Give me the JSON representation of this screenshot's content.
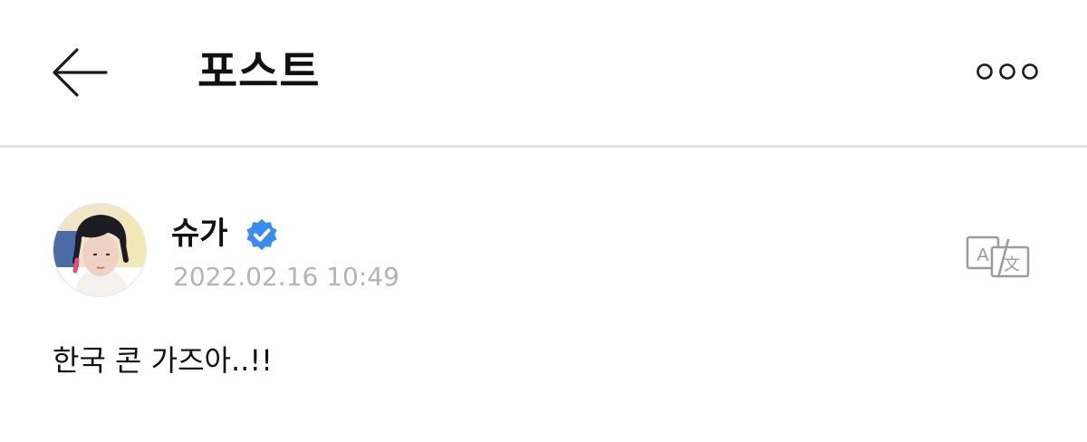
{
  "header": {
    "back_icon": "arrow-left-icon",
    "title": "포스트",
    "more_icon": "more-dots-icon"
  },
  "post": {
    "author": {
      "name": "슈가",
      "verified": true,
      "verified_color": "#3b8cf0",
      "avatar_icon": "profile-photo"
    },
    "timestamp": "2022.02.16 10:49",
    "translate_icon": "translate-icon",
    "body": "한국 콘 가즈아..!!"
  }
}
